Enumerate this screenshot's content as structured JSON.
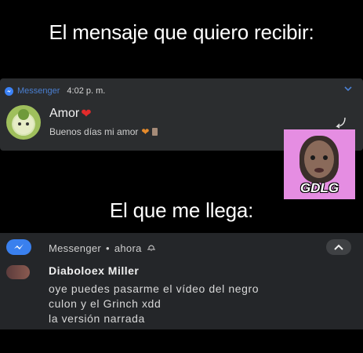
{
  "captions": {
    "top": "El mensaje que quiero recibir:",
    "bottom": "El que me llega:"
  },
  "wanted_notification": {
    "app_name": "Messenger",
    "time": "4:02 p. m.",
    "sender": "Amor",
    "message": "Buenos días mi amor",
    "heart_icon": "red-heart-icon"
  },
  "watermark": {
    "text": "GDLG"
  },
  "received_notification": {
    "app_name": "Messenger",
    "separator": "•",
    "time": "ahora",
    "sender": "Diaboloex Miller",
    "message_lines": [
      "oye puedes pasarme el vídeo del negro",
      "culon y el Grinch xdd",
      "la versión narrada"
    ]
  },
  "colors": {
    "background": "#000000",
    "notification_bg": "#2b2d2f",
    "messenger_blue": "#3a80ee",
    "heart_red": "#e22b2b",
    "watermark_pink": "#e58de2"
  }
}
